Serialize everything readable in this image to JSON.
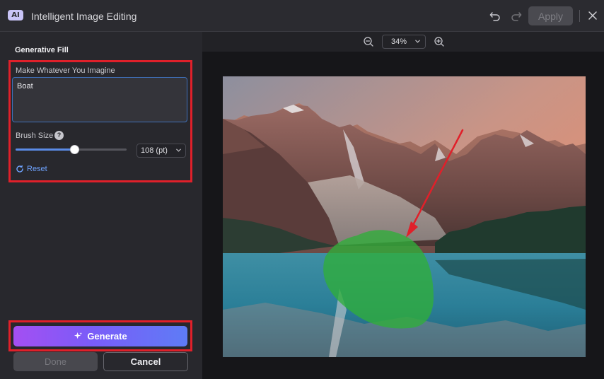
{
  "window": {
    "badge": "AI",
    "title": "Intelligent Image Editing",
    "apply_label": "Apply",
    "icons": [
      "undo-icon",
      "redo-icon",
      "close-icon"
    ]
  },
  "panel": {
    "heading": "Generative Fill",
    "prompt_label": "Make Whatever You Imagine",
    "prompt_value": "Boat",
    "brush_label": "Brush Size",
    "help_glyph": "?",
    "brush_level_percent": 53,
    "brush_size_value": "108 (pt)",
    "reset_label": "Reset",
    "generate_label": "Generate",
    "done_label": "Done",
    "cancel_label": "Cancel"
  },
  "canvas": {
    "zoom_value": "34%",
    "image_subject": "mountain lake",
    "mask_color": "#2fae3a",
    "annotation_color": "#e0202a"
  },
  "colors": {
    "accent": "#5b8be6",
    "highlight": "#e0202a",
    "generate_start": "#a44ff2",
    "generate_end": "#5e7cf6"
  }
}
